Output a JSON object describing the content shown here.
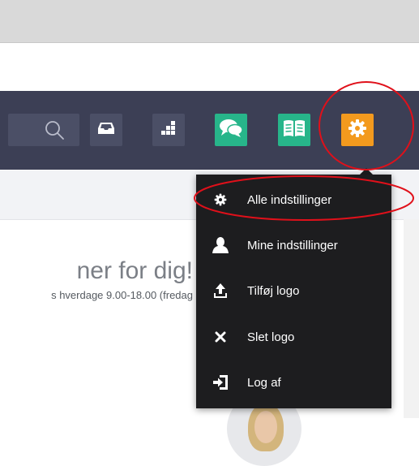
{
  "toolbar": {
    "search_icon": "search-icon",
    "inbox_icon": "inbox-icon",
    "dashboard_icon": "dashboard-icon",
    "chat_icon": "chat-icon",
    "book_icon": "book-icon",
    "settings_icon": "gear-icon"
  },
  "content": {
    "heading": "ner for dig!",
    "subline": "s hverdage 9.00-18.00 (fredag"
  },
  "settings_menu": {
    "items": [
      {
        "label": "Alle indstillinger",
        "icon": "gear-icon"
      },
      {
        "label": "Mine indstillinger",
        "icon": "user-icon"
      },
      {
        "label": "Tilføj logo",
        "icon": "upload-icon"
      },
      {
        "label": "Slet logo",
        "icon": "close-icon"
      },
      {
        "label": "Log af",
        "icon": "logout-icon"
      }
    ]
  },
  "colors": {
    "navbar": "#3c3f55",
    "green": "#27b58a",
    "orange": "#f39a1e",
    "menu_bg": "#1d1d1f",
    "annotation": "#e0101a"
  }
}
